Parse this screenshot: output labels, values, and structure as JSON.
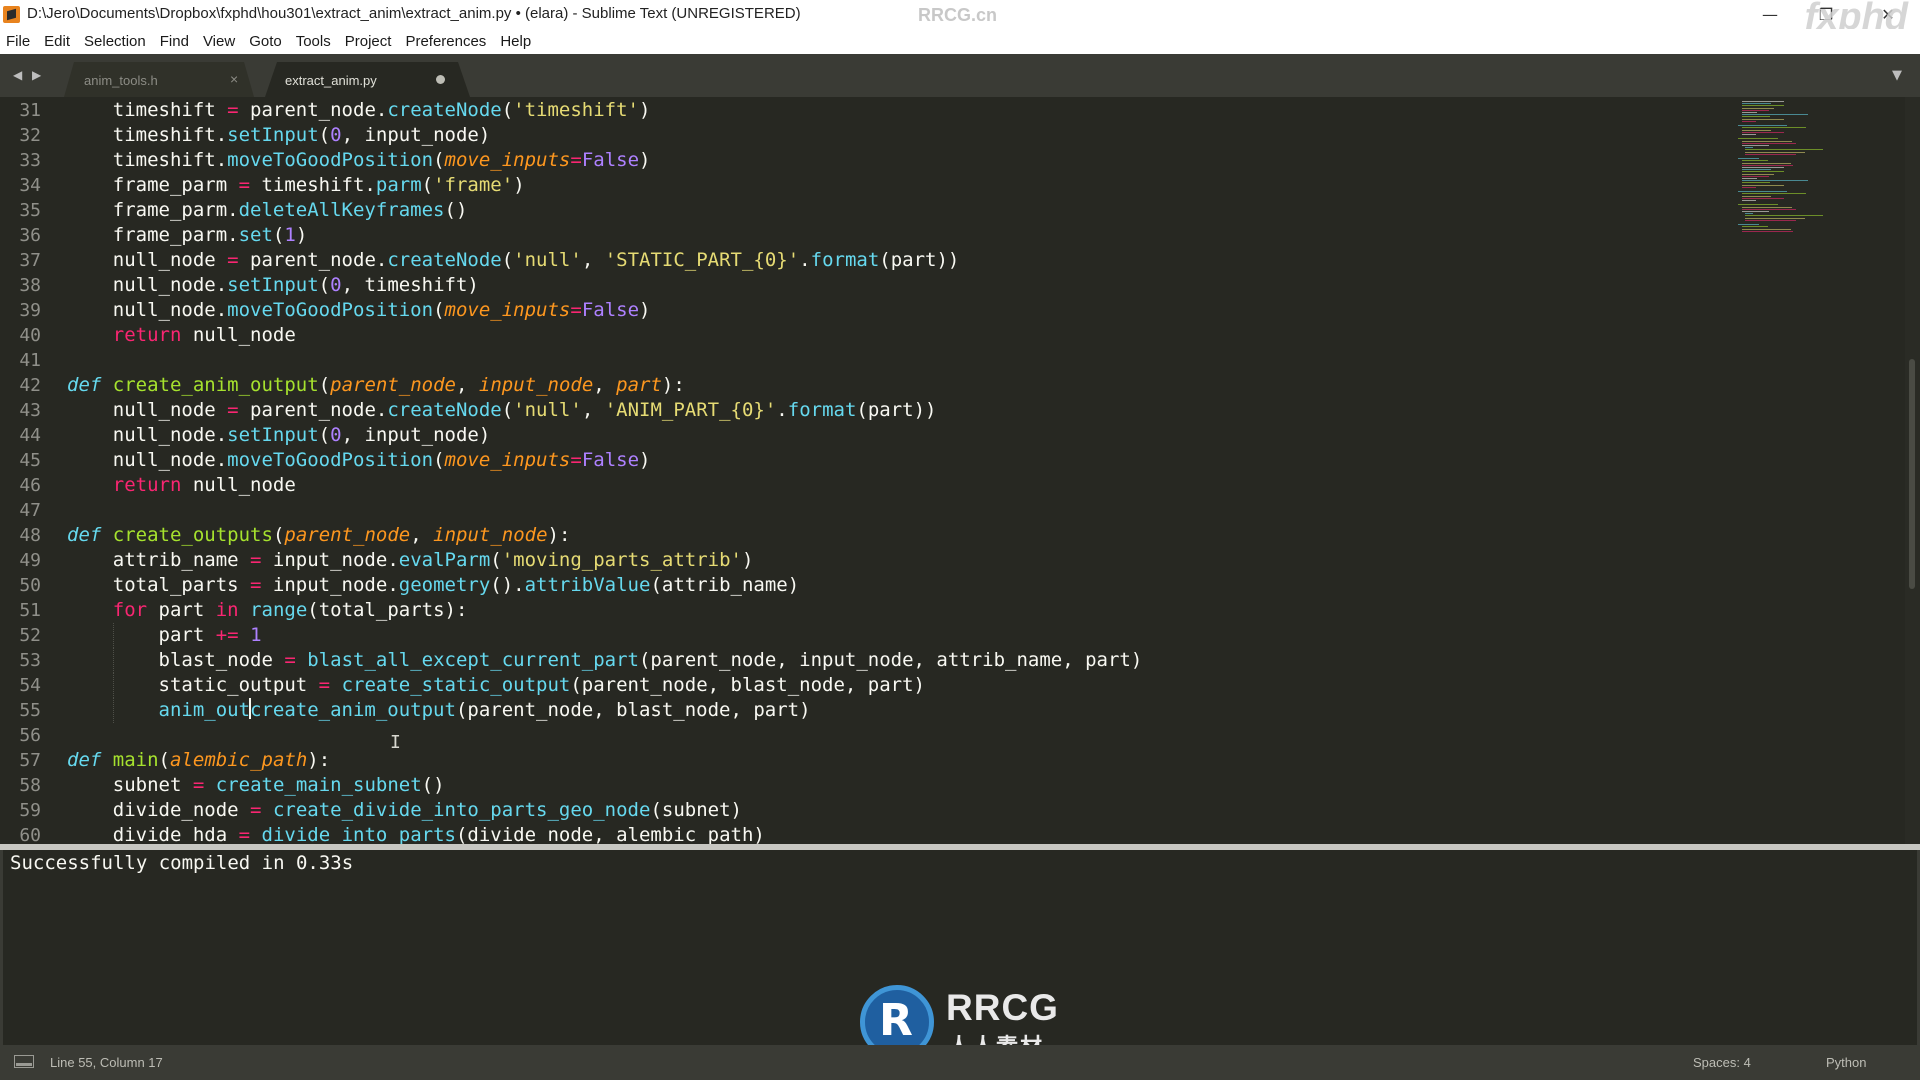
{
  "window": {
    "title": "D:\\Jero\\Documents\\Dropbox\\fxphd\\hou301\\extract_anim\\extract_anim.py • (elara) - Sublime Text (UNREGISTERED)",
    "watermark_top": "RRCG.cn",
    "watermark_corner": "fxphd",
    "minimize_icon": "minimize-icon",
    "maximize_icon": "restore-icon",
    "close_icon": "close-icon",
    "minimize_glyph": "—",
    "maximize_glyph": "❐",
    "close_glyph": "✕"
  },
  "menu": [
    "File",
    "Edit",
    "Selection",
    "Find",
    "View",
    "Goto",
    "Tools",
    "Project",
    "Preferences",
    "Help"
  ],
  "tabs": [
    {
      "label": "anim_tools.h",
      "active": false,
      "close_glyph": "×"
    },
    {
      "label": "extract_anim.py",
      "active": true,
      "dirty": true
    }
  ],
  "nav": {
    "left_glyph": "◀",
    "right_glyph": "▶",
    "dropdown_glyph": "▼"
  },
  "editor": {
    "line_numbers": [
      "31",
      "32",
      "33",
      "34",
      "35",
      "36",
      "37",
      "38",
      "39",
      "40",
      "41",
      "42",
      "43",
      "44",
      "45",
      "46",
      "47",
      "48",
      "49",
      "50",
      "51",
      "52",
      "53",
      "54",
      "55",
      "56",
      "57",
      "58",
      "59",
      "60"
    ],
    "cursor": {
      "line": 55,
      "column": 17
    },
    "ibeam_glyph": "I",
    "code_lines": [
      "    timeshift = parent_node.createNode('timeshift')",
      "    timeshift.setInput(0, input_node)",
      "    timeshift.moveToGoodPosition(move_inputs=False)",
      "    frame_parm = timeshift.parm('frame')",
      "    frame_parm.deleteAllKeyframes()",
      "    frame_parm.set(1)",
      "    null_node = parent_node.createNode('null', 'STATIC_PART_{0}'.format(part))",
      "    null_node.setInput(0, timeshift)",
      "    null_node.moveToGoodPosition(move_inputs=False)",
      "    return null_node",
      "",
      "def create_anim_output(parent_node, input_node, part):",
      "    null_node = parent_node.createNode('null', 'ANIM_PART_{0}'.format(part))",
      "    null_node.setInput(0, input_node)",
      "    null_node.moveToGoodPosition(move_inputs=False)",
      "    return null_node",
      "",
      "def create_outputs(parent_node, input_node):",
      "    attrib_name = input_node.evalParm('moving_parts_attrib')",
      "    total_parts = input_node.geometry().attribValue(attrib_name)",
      "    for part in range(total_parts):",
      "        part += 1",
      "        blast_node = blast_all_except_current_part(parent_node, input_node, attrib_name, part)",
      "        static_output = create_static_output(parent_node, blast_node, part)",
      "        anim_outcreate_anim_output(parent_node, blast_node, part)",
      "",
      "def main(alembic_path):",
      "    subnet = create_main_subnet()",
      "    divide_node = create_divide_into_parts_geo_node(subnet)",
      "    divide_hda = divide_into_parts(divide_node, alembic_path)"
    ]
  },
  "output_panel": {
    "text": "Successfully compiled in 0.33s"
  },
  "logo": {
    "word": "RRCG",
    "sub": "人人素材"
  },
  "status": {
    "position": "Line 55, Column 17",
    "spaces": "Spaces: 4",
    "syntax": "Python"
  },
  "colors": {
    "background": "#272822",
    "keyword": "#f92672",
    "function": "#a6e22e",
    "builtin": "#66d9ef",
    "string": "#e6db74",
    "number": "#ae81ff",
    "parameter": "#fd971f",
    "text": "#f8f8f2"
  }
}
